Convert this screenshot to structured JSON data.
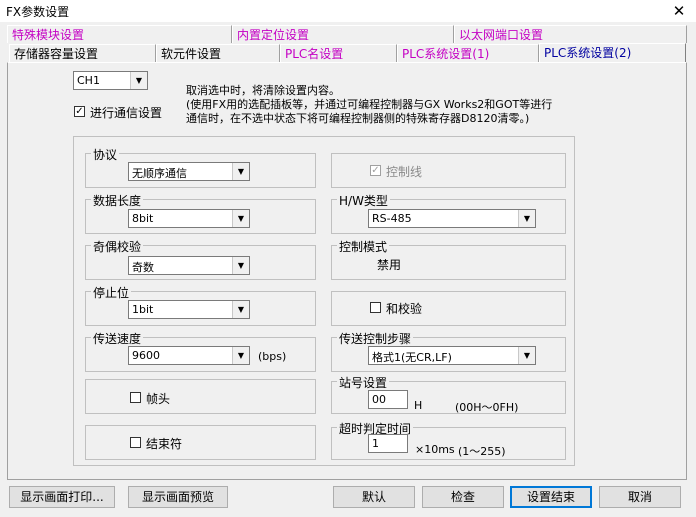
{
  "window": {
    "title": "FX参数设置"
  },
  "tabs_row1": [
    "特殊模块设置",
    "内置定位设置",
    "以太网端口设置"
  ],
  "tabs_row2": [
    "存储器容量设置",
    "软元件设置",
    "PLC名设置",
    "PLC系统设置(1)",
    "PLC系统设置(2)"
  ],
  "channel": {
    "value": "CH1"
  },
  "comm": {
    "checkbox_label": "进行通信设置",
    "note": "取消选中时，将清除设置内容。\n(使用FX用的选配插板等，并通过可编程控制器与GX Works2和GOT等进行\n通信时，在不选中状态下将可编程控制器侧的特殊寄存器D8120清零。)"
  },
  "protocol": {
    "label": "协议",
    "value": "无顺序通信"
  },
  "data_length": {
    "label": "数据长度",
    "value": "8bit"
  },
  "parity": {
    "label": "奇偶校验",
    "value": "奇数"
  },
  "stop_bit": {
    "label": "停止位",
    "value": "1bit"
  },
  "baud": {
    "label": "传送速度",
    "value": "9600",
    "unit": "(bps)"
  },
  "header": {
    "label": "帧头"
  },
  "terminator": {
    "label": "结束符"
  },
  "control_line": {
    "label": "控制线"
  },
  "hw_type": {
    "label": "H/W类型",
    "value": "RS-485"
  },
  "control_mode": {
    "label": "控制模式",
    "value": "禁用"
  },
  "sum_check": {
    "label": "和校验"
  },
  "transfer_control": {
    "label": "传送控制步骤",
    "value": "格式1(无CR,LF)"
  },
  "station": {
    "label": "站号设置",
    "value": "00",
    "unit": "H",
    "range": "(00H～0FH)"
  },
  "timeout": {
    "label": "超时判定时间",
    "value": "1",
    "unit": "×10ms",
    "range": "(1～255)"
  },
  "buttons": {
    "print": "显示画面打印...",
    "preview": "显示画面预览",
    "default": "默认",
    "check": "检查",
    "finish": "设置结束",
    "cancel": "取消"
  },
  "colors": {
    "tab_magenta": "#c400c4",
    "tab_active_text": "#0000a0",
    "selection": "#0a64d2"
  }
}
